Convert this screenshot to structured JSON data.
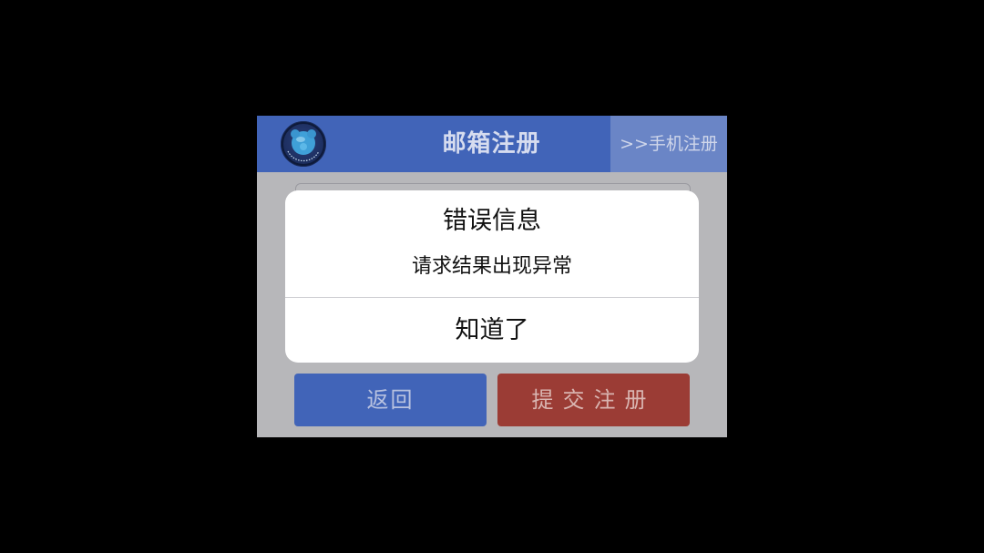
{
  "header": {
    "title": "邮箱注册",
    "phone_register_link": ">>手机注册",
    "logo_icon": "blue-panda-logo"
  },
  "buttons": {
    "back_label": "返回",
    "submit_label": "提交注册"
  },
  "dialog": {
    "title": "错误信息",
    "message": "请求结果出现异常",
    "confirm_label": "知道了"
  },
  "colors": {
    "header_bg": "#4164b8",
    "phone_link_bg": "#6a85c6",
    "back_button_bg": "#4164b8",
    "submit_button_bg": "#9b3c35",
    "overlay_bg": "#b7b7ba",
    "dialog_bg": "#ffffff"
  }
}
